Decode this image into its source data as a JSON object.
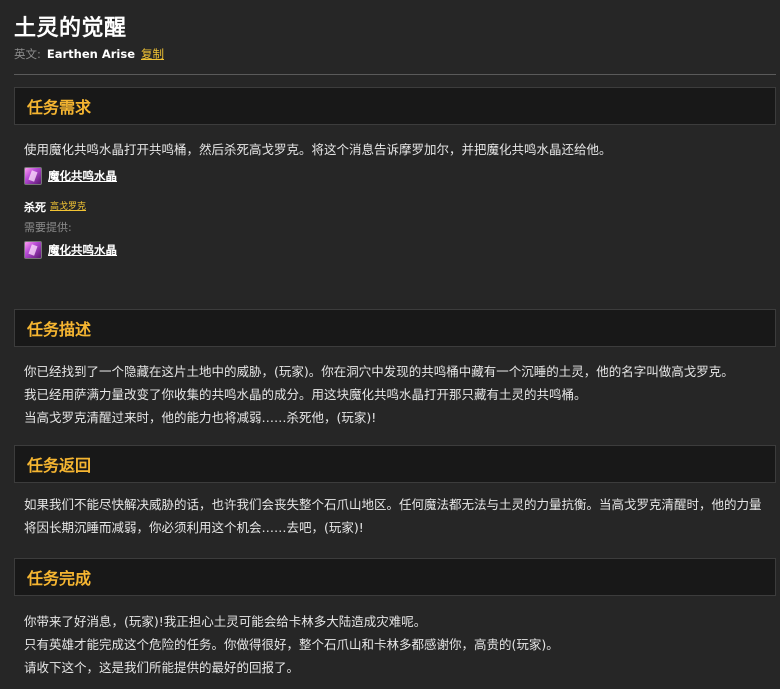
{
  "quest": {
    "title": "土灵的觉醒",
    "english_label": "英文:",
    "english_name": "Earthen Arise",
    "copy_label": "复制"
  },
  "objectives": {
    "heading": "任务需求",
    "text": "使用魔化共鸣水晶打开共鸣桶，然后杀死高戈罗克。将这个消息告诉摩罗加尔，并把魔化共鸣水晶还给他。",
    "item_required": {
      "name": "魔化共鸣水晶",
      "icon": "crystal-icon"
    },
    "kill_label": "杀死",
    "kill_target": "高戈罗克",
    "provided_label": "需要提供:",
    "item_provided": {
      "name": "魔化共鸣水晶",
      "icon": "crystal-icon"
    }
  },
  "description": {
    "heading": "任务描述",
    "lines": [
      "你已经找到了一个隐藏在这片土地中的威胁，(玩家)。你在洞穴中发现的共鸣桶中藏有一个沉睡的土灵，他的名字叫做高戈罗克。",
      "我已经用萨满力量改变了你收集的共鸣水晶的成分。用这块魔化共鸣水晶打开那只藏有土灵的共鸣桶。",
      "当高戈罗克清醒过来时，他的能力也将减弱……杀死他，(玩家)!"
    ]
  },
  "progress": {
    "heading": "任务返回",
    "text": "如果我们不能尽快解决威胁的话，也许我们会丧失整个石爪山地区。任何魔法都无法与土灵的力量抗衡。当高戈罗克清醒时，他的力量将因长期沉睡而减弱，你必须利用这个机会……去吧，(玩家)!"
  },
  "completion": {
    "heading": "任务完成",
    "lines": [
      "你带来了好消息，(玩家)!我正担心土灵可能会给卡林多大陆造成灾难呢。",
      "只有英雄才能完成这个危险的任务。你做得很好，整个石爪山和卡林多都感谢你，高贵的(玩家)。",
      "请收下这个，这是我们所能提供的最好的回报了。"
    ]
  },
  "colors": {
    "background": "#262626",
    "section_header_bg": "#181818",
    "heading_gold": "#f5b531",
    "link_gold": "#f2c434"
  }
}
